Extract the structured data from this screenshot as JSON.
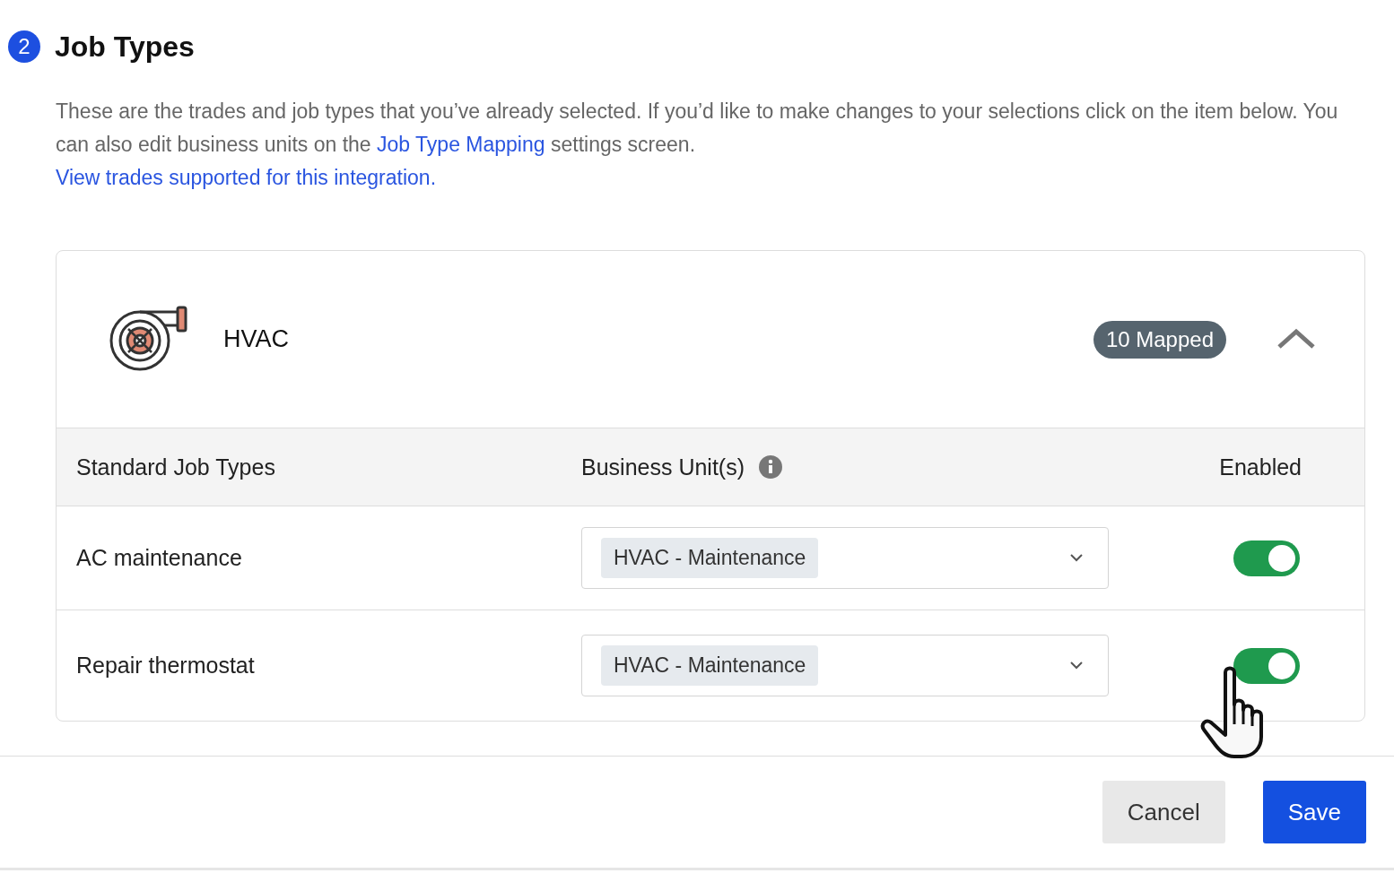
{
  "section": {
    "step": "2",
    "title": "Job Types"
  },
  "description": {
    "text_before": "These are the trades and job types that you’ve already selected. If you’d like to make changes to your selections click on the item below. You can also edit business units on the",
    "link": "Job Type Mapping",
    "text_after": "settings screen."
  },
  "trades_link": "View trades supported for this integration.",
  "trade": {
    "name": "HVAC",
    "badge": "10 Mapped",
    "expanded": true,
    "columns": [
      "Standard Job Types",
      "Business Unit(s)",
      "Enabled"
    ],
    "rows": [
      {
        "job_type": "AC maintenance",
        "business_unit": "HVAC - Maintenance",
        "enabled": true
      },
      {
        "job_type": "Repair thermostat",
        "business_unit": "HVAC - Maintenance",
        "enabled": true
      }
    ]
  },
  "buttons": [
    {
      "label": "Cancel",
      "kind": "secondary"
    },
    {
      "label": "Save",
      "kind": "primary"
    }
  ]
}
